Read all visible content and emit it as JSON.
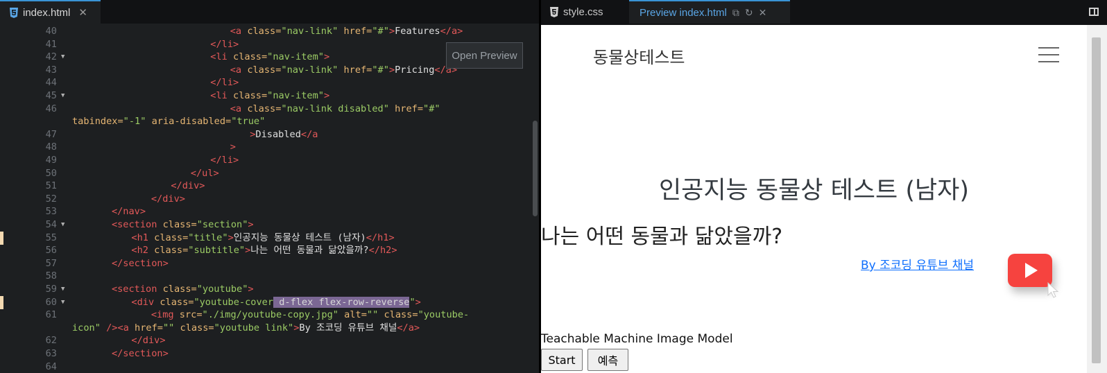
{
  "left_tabs": {
    "active": "index.html",
    "close_glyph": "✕"
  },
  "right_tabs": {
    "style": "style.css",
    "preview": "Preview index.html",
    "close_glyph": "✕"
  },
  "editor": {
    "open_preview": "Open Preview",
    "lines": [
      {
        "n": "40",
        "fold": false,
        "mark": false,
        "ind": 32,
        "seg": [
          [
            "tag",
            "<a "
          ],
          [
            "attr",
            "class="
          ],
          [
            "str",
            "\"nav-link\""
          ],
          [
            "attr",
            " href="
          ],
          [
            "str",
            "\"#\""
          ],
          [
            "tag",
            ">"
          ],
          [
            "txt",
            "Features"
          ],
          [
            "tag",
            "</a>"
          ]
        ]
      },
      {
        "n": "41",
        "fold": false,
        "mark": false,
        "ind": 28,
        "seg": [
          [
            "tag",
            "</li>"
          ]
        ]
      },
      {
        "n": "42",
        "fold": true,
        "mark": false,
        "ind": 28,
        "seg": [
          [
            "tag",
            "<li "
          ],
          [
            "attr",
            "class="
          ],
          [
            "str",
            "\"nav-item\""
          ],
          [
            "tag",
            ">"
          ]
        ]
      },
      {
        "n": "43",
        "fold": false,
        "mark": false,
        "ind": 32,
        "seg": [
          [
            "tag",
            "<a "
          ],
          [
            "attr",
            "class="
          ],
          [
            "str",
            "\"nav-link\""
          ],
          [
            "attr",
            " href="
          ],
          [
            "str",
            "\"#\""
          ],
          [
            "tag",
            ">"
          ],
          [
            "txt",
            "Pricing"
          ],
          [
            "tag",
            "</a>"
          ]
        ]
      },
      {
        "n": "44",
        "fold": false,
        "mark": false,
        "ind": 28,
        "seg": [
          [
            "tag",
            "</li>"
          ]
        ]
      },
      {
        "n": "45",
        "fold": true,
        "mark": false,
        "ind": 28,
        "seg": [
          [
            "tag",
            "<li "
          ],
          [
            "attr",
            "class="
          ],
          [
            "str",
            "\"nav-item\""
          ],
          [
            "tag",
            ">"
          ]
        ]
      },
      {
        "n": "46",
        "fold": false,
        "mark": false,
        "ind": 32,
        "seg": [
          [
            "tag",
            "<a "
          ],
          [
            "attr",
            "class="
          ],
          [
            "str",
            "\"nav-link disabled\""
          ],
          [
            "attr",
            " href="
          ],
          [
            "str",
            "\"#\""
          ]
        ]
      },
      {
        "n": "",
        "fold": false,
        "mark": false,
        "ind": 0,
        "seg": [
          [
            "attr",
            "tabindex="
          ],
          [
            "str",
            "\"-1\""
          ],
          [
            "attr",
            " aria-disabled="
          ],
          [
            "str",
            "\"true\""
          ]
        ]
      },
      {
        "n": "47",
        "fold": false,
        "mark": false,
        "ind": 36,
        "seg": [
          [
            "tag",
            ">"
          ],
          [
            "txt",
            "Disabled"
          ],
          [
            "tag",
            "</a"
          ]
        ]
      },
      {
        "n": "48",
        "fold": false,
        "mark": false,
        "ind": 32,
        "seg": [
          [
            "tag",
            ">"
          ]
        ]
      },
      {
        "n": "49",
        "fold": false,
        "mark": false,
        "ind": 28,
        "seg": [
          [
            "tag",
            "</li>"
          ]
        ]
      },
      {
        "n": "50",
        "fold": false,
        "mark": false,
        "ind": 24,
        "seg": [
          [
            "tag",
            "</ul>"
          ]
        ]
      },
      {
        "n": "51",
        "fold": false,
        "mark": false,
        "ind": 20,
        "seg": [
          [
            "tag",
            "</div>"
          ]
        ]
      },
      {
        "n": "52",
        "fold": false,
        "mark": false,
        "ind": 16,
        "seg": [
          [
            "tag",
            "</div>"
          ]
        ]
      },
      {
        "n": "53",
        "fold": false,
        "mark": false,
        "ind": 8,
        "seg": [
          [
            "tag",
            "</nav>"
          ]
        ]
      },
      {
        "n": "54",
        "fold": true,
        "mark": false,
        "ind": 8,
        "seg": [
          [
            "tag",
            "<section "
          ],
          [
            "attr",
            "class="
          ],
          [
            "str",
            "\"section\""
          ],
          [
            "tag",
            ">"
          ]
        ]
      },
      {
        "n": "55",
        "fold": false,
        "mark": true,
        "ind": 12,
        "seg": [
          [
            "tag",
            "<h1 "
          ],
          [
            "attr",
            "class="
          ],
          [
            "str",
            "\"title\""
          ],
          [
            "tag",
            ">"
          ],
          [
            "txt",
            "인공지능 동물상 테스트 (남자)"
          ],
          [
            "tag",
            "</h1>"
          ]
        ]
      },
      {
        "n": "56",
        "fold": false,
        "mark": false,
        "ind": 12,
        "seg": [
          [
            "tag",
            "<h2 "
          ],
          [
            "attr",
            "class="
          ],
          [
            "str",
            "\"subtitle\""
          ],
          [
            "tag",
            ">"
          ],
          [
            "txt",
            "나는 어떤 동물과 닮았을까?"
          ],
          [
            "tag",
            "</h2>"
          ]
        ]
      },
      {
        "n": "57",
        "fold": false,
        "mark": false,
        "ind": 8,
        "seg": [
          [
            "tag",
            "</section>"
          ]
        ]
      },
      {
        "n": "58",
        "fold": false,
        "mark": false,
        "ind": 0,
        "seg": []
      },
      {
        "n": "59",
        "fold": true,
        "mark": false,
        "ind": 8,
        "seg": [
          [
            "tag",
            "<section "
          ],
          [
            "attr",
            "class="
          ],
          [
            "str",
            "\"youtube\""
          ],
          [
            "tag",
            ">"
          ]
        ]
      },
      {
        "n": "60",
        "fold": true,
        "mark": true,
        "ind": 12,
        "seg": [
          [
            "tag",
            "<div "
          ],
          [
            "attr",
            "class="
          ],
          [
            "str",
            "\"youtube-cover"
          ],
          [
            "hl",
            " d-flex flex-row-reverse"
          ],
          [
            "str",
            "\""
          ],
          [
            "tag",
            ">"
          ]
        ]
      },
      {
        "n": "61",
        "fold": false,
        "mark": false,
        "ind": 16,
        "seg": [
          [
            "tag",
            "<img "
          ],
          [
            "attr",
            "src="
          ],
          [
            "str",
            "\"./img/youtube-copy.jpg\""
          ],
          [
            "attr",
            " alt="
          ],
          [
            "str",
            "\"\""
          ],
          [
            "attr",
            " class="
          ],
          [
            "str",
            "\"youtube-"
          ]
        ]
      },
      {
        "n": "",
        "fold": false,
        "mark": false,
        "ind": 0,
        "seg": [
          [
            "str",
            "icon\""
          ],
          [
            "tag",
            " /><a "
          ],
          [
            "attr",
            "href="
          ],
          [
            "str",
            "\"\""
          ],
          [
            "attr",
            " class="
          ],
          [
            "str",
            "\"youtube link\""
          ],
          [
            "tag",
            ">"
          ],
          [
            "txt",
            "By 조코딩 유튜브 채널"
          ],
          [
            "tag",
            "</a>"
          ]
        ]
      },
      {
        "n": "62",
        "fold": false,
        "mark": false,
        "ind": 12,
        "seg": [
          [
            "tag",
            "</div>"
          ]
        ]
      },
      {
        "n": "63",
        "fold": false,
        "mark": false,
        "ind": 8,
        "seg": [
          [
            "tag",
            "</section>"
          ]
        ]
      },
      {
        "n": "64",
        "fold": false,
        "mark": false,
        "ind": 0,
        "seg": []
      }
    ]
  },
  "preview": {
    "brand": "동물상테스트",
    "title": "인공지능 동물상 테스트 (남자)",
    "subtitle": "나는 어떤 동물과 닮았을까?",
    "youtube_link": "By 조코딩 유튜브 채널",
    "tm_label": "Teachable Machine Image Model",
    "start_button": "Start",
    "predict_button": "예측"
  }
}
